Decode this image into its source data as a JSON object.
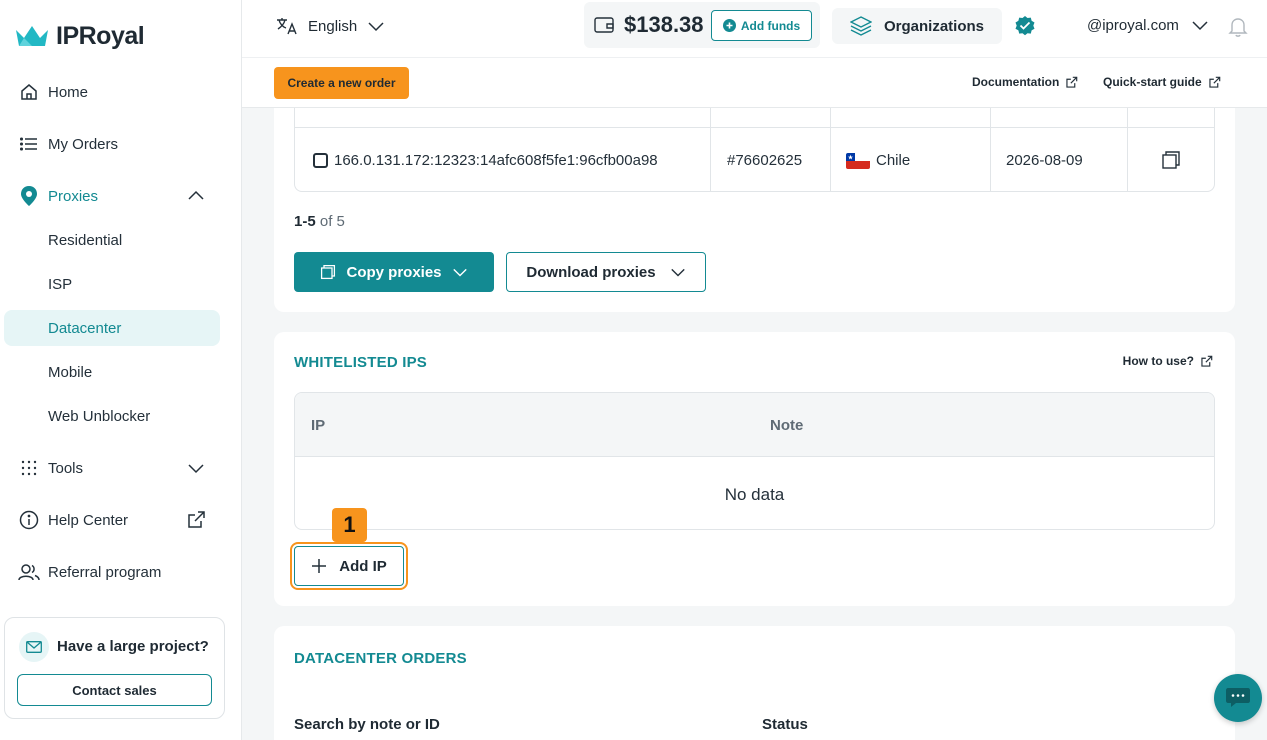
{
  "brand": {
    "name": "IPRoyal",
    "accent": "#138a92",
    "orange": "#f7941d"
  },
  "sidebar": {
    "items": [
      {
        "label": "Home",
        "icon": "home-icon"
      },
      {
        "label": "My Orders",
        "icon": "list-icon"
      },
      {
        "label": "Proxies",
        "icon": "location-pin-icon"
      },
      {
        "label": "Tools",
        "icon": "grid-dots-icon"
      },
      {
        "label": "Help Center",
        "icon": "info-icon"
      },
      {
        "label": "Referral program",
        "icon": "users-icon"
      }
    ],
    "proxies_sub": [
      "Residential",
      "ISP",
      "Datacenter",
      "Mobile",
      "Web Unblocker"
    ],
    "promo": {
      "title": "Have a large project?",
      "button": "Contact sales"
    }
  },
  "topbar": {
    "language": "English",
    "balance": "$138.38",
    "add_funds": "Add funds",
    "organizations": "Organizations",
    "account": "@iproyal.com",
    "create_order": "Create a new order",
    "documentation": "Documentation",
    "quickstart": "Quick-start guide"
  },
  "proxy_list": {
    "row": {
      "proxy": "166.0.131.172:12323:14afc608f5fe1:96cfb00a98",
      "order": "#76602625",
      "country": "Chile",
      "expires": "2026-08-09"
    },
    "pager_range": "1-5",
    "pager_total": "of 5",
    "copy_button": "Copy proxies",
    "download_button": "Download proxies"
  },
  "whitelisted": {
    "title": "WHITELISTED IPS",
    "howto": "How to use?",
    "columns": [
      "IP",
      "Note"
    ],
    "empty": "No data",
    "add_button": "Add IP",
    "marker": "1"
  },
  "orders": {
    "title": "DATACENTER ORDERS",
    "search_label": "Search by note or ID",
    "status_label": "Status"
  }
}
